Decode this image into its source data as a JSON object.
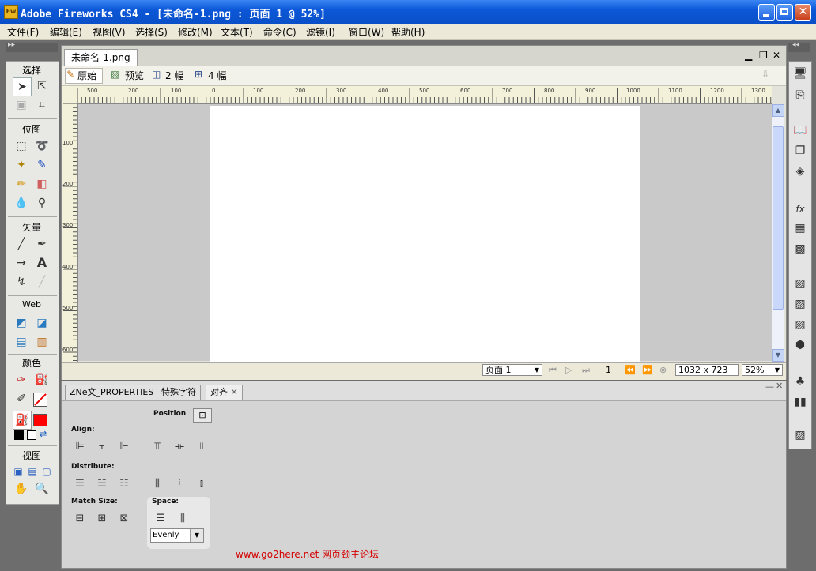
{
  "window": {
    "title": "Adobe Fireworks CS4 - [未命名-1.png : 页面 1 @  52%]",
    "app_icon": "Fw"
  },
  "menu": [
    "文件(F)",
    "编辑(E)",
    "视图(V)",
    "选择(S)",
    "修改(M)",
    "文本(T)",
    "命令(C)",
    "滤镜(I)",
    "窗口(W)",
    "帮助(H)"
  ],
  "toolbox": {
    "sections": [
      "选择",
      "位图",
      "矢量",
      "Web",
      "颜色",
      "视图"
    ]
  },
  "document": {
    "tab": "未命名-1.png",
    "views": [
      "原始",
      "预览",
      "2 幅",
      "4 幅"
    ],
    "hruler_labels": [
      "500",
      "200",
      "100",
      "0",
      "100",
      "200",
      "300",
      "400",
      "500",
      "600",
      "700",
      "800",
      "900",
      "1000",
      "1100",
      "1200",
      "1300"
    ],
    "vruler_labels": [
      "100",
      "200",
      "300",
      "400",
      "500",
      "600"
    ]
  },
  "status": {
    "page": "页面 1",
    "frame": "1",
    "size": "1032 x 723",
    "zoom": "52%"
  },
  "panel": {
    "tabs": [
      "ZNe文_PROPERTIES",
      "特殊字符",
      "对齐"
    ],
    "position_label": "Position",
    "align_label": "Align:",
    "distribute_label": "Distribute:",
    "match_size_label": "Match Size:",
    "space_label": "Space:",
    "space_option": "Evenly"
  },
  "watermark": "www.go2here.net 网页颈主论坛"
}
